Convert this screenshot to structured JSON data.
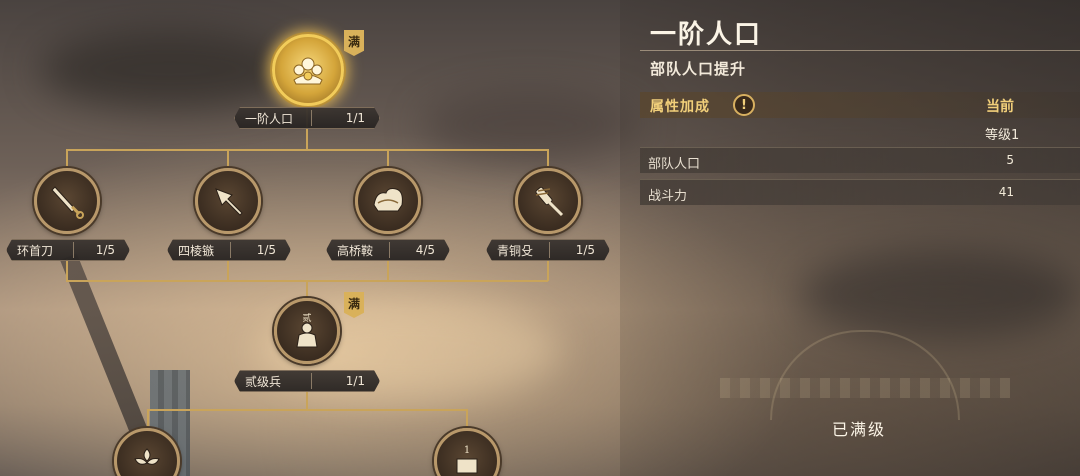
{
  "tree": {
    "top_node": {
      "name": "一阶人口",
      "progress": "1/1",
      "badge": "满",
      "icon": "ornament-crown-icon"
    },
    "tier1_nodes": [
      {
        "name": "环首刀",
        "progress": "1/5",
        "icon": "sword-icon"
      },
      {
        "name": "四棱镞",
        "progress": "1/5",
        "icon": "arrowhead-icon"
      },
      {
        "name": "高桥鞍",
        "progress": "4/5",
        "icon": "saddle-icon"
      },
      {
        "name": "青铜殳",
        "progress": "1/5",
        "icon": "mace-icon"
      }
    ],
    "mid_node": {
      "name": "贰级兵",
      "progress": "1/1",
      "badge": "满",
      "icon": "soldier-icon",
      "emblem_text": "贰"
    },
    "bottom_nodes": [
      {
        "icon": "flower-icon"
      },
      {
        "icon": "banner-icon",
        "emblem_text": "1"
      }
    ]
  },
  "detail": {
    "title": "一阶人口",
    "subtitle": "部队人口提升",
    "attr_header": "属性加成",
    "attr_alert": "!",
    "current_label": "当前",
    "level_label": "等级1",
    "stats": [
      {
        "name": "部队人口",
        "value": "5"
      },
      {
        "name": "战斗力",
        "value": "41"
      }
    ],
    "status": "已满级"
  },
  "colors": {
    "gold": "#c9a45a",
    "accent_text": "#f1cf7a",
    "badge": "#d9b15a"
  }
}
